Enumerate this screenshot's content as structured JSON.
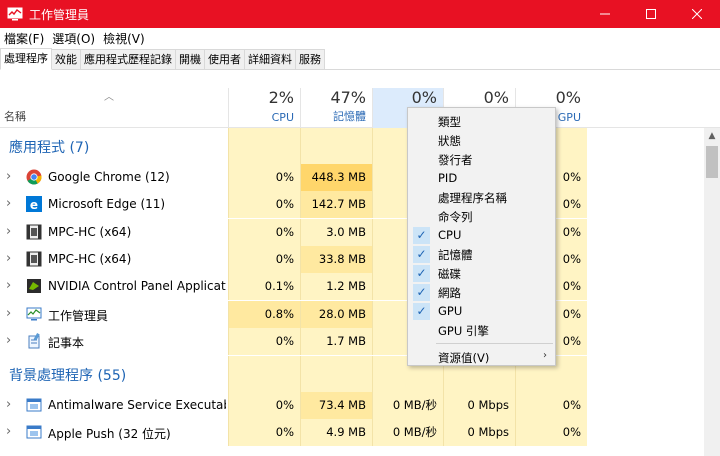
{
  "window": {
    "title": "工作管理員"
  },
  "menus": [
    "檔案(F)",
    "選項(O)",
    "檢視(V)"
  ],
  "tabs": [
    "處理程序",
    "效能",
    "應用程式歷程記錄",
    "開機",
    "使用者",
    "詳細資料",
    "服務"
  ],
  "columns": {
    "name": "名稱",
    "cpu": {
      "pct": "2%",
      "label": "CPU"
    },
    "memory": {
      "pct": "47%",
      "label": "記憶體"
    },
    "disk": {
      "pct": "0%"
    },
    "network": {
      "pct": "0%"
    },
    "gpu": {
      "pct": "0%",
      "label": "GPU"
    }
  },
  "groups": [
    {
      "title": "應用程式 (7)",
      "rows": [
        {
          "name": "Google Chrome (12)",
          "icon": "chrome-icon",
          "cpu": "0%",
          "mem": "448.3 MB",
          "disk": "0 M",
          "net": "",
          "gpu": "0%"
        },
        {
          "name": "Microsoft Edge (11)",
          "icon": "edge-icon",
          "cpu": "0%",
          "mem": "142.7 MB",
          "disk": "0 M",
          "net": "",
          "gpu": "0%"
        },
        {
          "name": "MPC-HC (x64)",
          "icon": "mpc-icon",
          "cpu": "0%",
          "mem": "3.0 MB",
          "disk": "0 M",
          "net": "",
          "gpu": "0%"
        },
        {
          "name": "MPC-HC (x64)",
          "icon": "mpc-icon",
          "cpu": "0%",
          "mem": "33.8 MB",
          "disk": "0 M",
          "net": "",
          "gpu": "0%"
        },
        {
          "name": "NVIDIA Control Panel Applicat...",
          "icon": "nvidia-icon",
          "cpu": "0.1%",
          "mem": "1.2 MB",
          "disk": "0 M",
          "net": "",
          "gpu": "0%"
        },
        {
          "name": "工作管理員",
          "icon": "task-manager-icon",
          "cpu": "0.8%",
          "mem": "28.0 MB",
          "disk": "0 M",
          "net": "",
          "gpu": "0%"
        },
        {
          "name": "記事本",
          "icon": "notepad-icon",
          "cpu": "0%",
          "mem": "1.7 MB",
          "disk": "0 M",
          "net": "",
          "gpu": "0%"
        }
      ]
    },
    {
      "title": "背景處理程序 (55)",
      "rows": [
        {
          "name": "Antimalware Service Executable",
          "icon": "service-icon",
          "cpu": "0%",
          "mem": "73.4 MB",
          "disk": "0 MB/秒",
          "net": "0 Mbps",
          "gpu": "0%"
        },
        {
          "name": "Apple Push (32 位元)",
          "icon": "service-icon",
          "cpu": "0%",
          "mem": "4.9 MB",
          "disk": "0 MB/秒",
          "net": "0 Mbps",
          "gpu": "0%"
        }
      ]
    }
  ],
  "context_menu": [
    {
      "label": "類型",
      "checked": false
    },
    {
      "label": "狀態",
      "checked": false
    },
    {
      "label": "發行者",
      "checked": false
    },
    {
      "label": "PID",
      "checked": false
    },
    {
      "label": "處理程序名稱",
      "checked": false
    },
    {
      "label": "命令列",
      "checked": false
    },
    {
      "label": "CPU",
      "checked": true
    },
    {
      "label": "記憶體",
      "checked": true
    },
    {
      "label": "磁碟",
      "checked": true
    },
    {
      "label": "網路",
      "checked": true
    },
    {
      "label": "GPU",
      "checked": true
    },
    {
      "label": "GPU 引擎",
      "checked": false
    },
    {
      "label": "資源值(V)",
      "checked": false,
      "submenu": true
    }
  ],
  "colors": {
    "titlebar": "#e81123",
    "accent": "#1e64b4",
    "heat_low": "#fff4c4",
    "heat_mid": "#ffe9a0",
    "heat_high": "#ffd66b"
  }
}
